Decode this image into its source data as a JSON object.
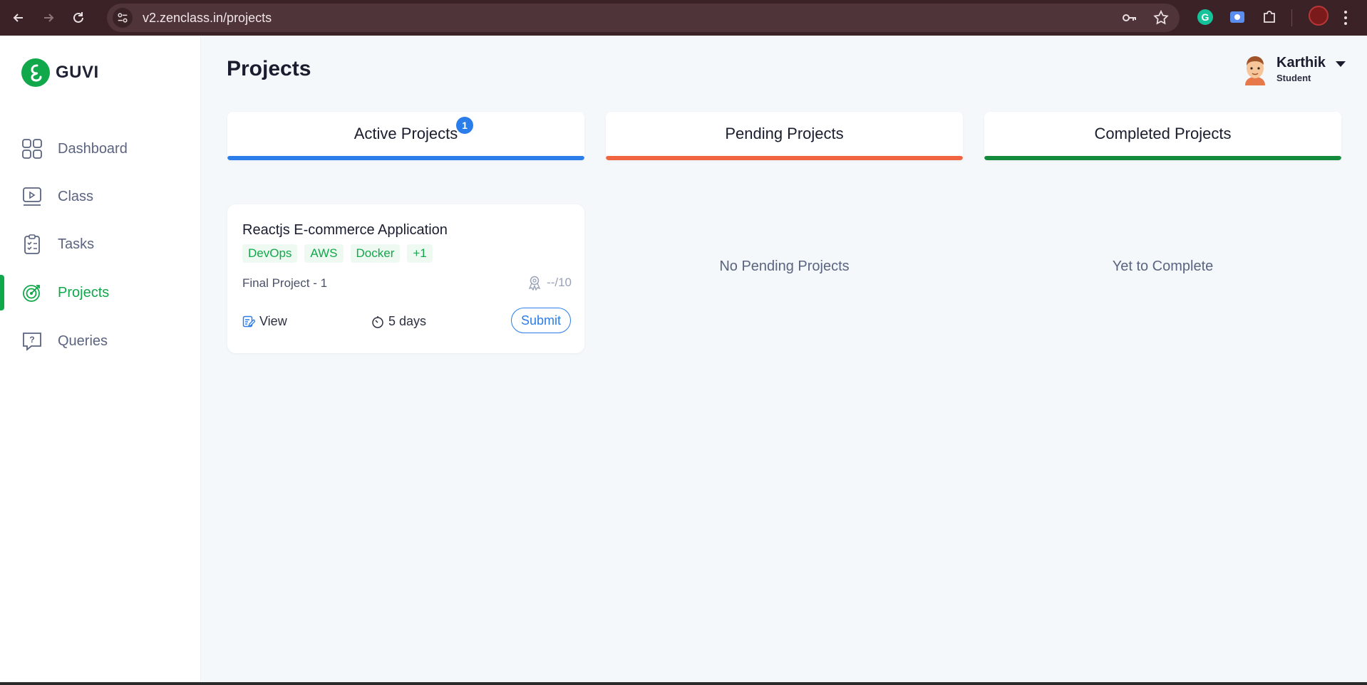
{
  "browser": {
    "url": "v2.zenclass.in/projects"
  },
  "brand": {
    "name": "GUVI"
  },
  "sidebar": {
    "items": [
      {
        "label": "Dashboard",
        "icon": "dashboard-grid-icon"
      },
      {
        "label": "Class",
        "icon": "video-class-icon"
      },
      {
        "label": "Tasks",
        "icon": "clipboard-tasks-icon"
      },
      {
        "label": "Projects",
        "icon": "target-projects-icon",
        "active": true
      },
      {
        "label": "Queries",
        "icon": "question-chat-icon"
      }
    ]
  },
  "header": {
    "title": "Projects",
    "user": {
      "name": "Karthik",
      "role": "Student"
    }
  },
  "tabs": [
    {
      "label": "Active Projects",
      "color": "#2b7de9",
      "badge": "1"
    },
    {
      "label": "Pending Projects",
      "color": "#f0643f"
    },
    {
      "label": "Completed Projects",
      "color": "#138a3c"
    }
  ],
  "project_card": {
    "title": "Reactjs E-commerce Application",
    "tags": [
      "DevOps",
      "AWS",
      "Docker",
      "+1"
    ],
    "subtitle": "Final Project - 1",
    "score": "--/10",
    "view_label": "View",
    "duration": "5 days",
    "submit_label": "Submit"
  },
  "pending_empty": "No Pending Projects",
  "completed_empty": "Yet to Complete",
  "colors": {
    "accent_green": "#11a84b",
    "accent_blue": "#2b7de9",
    "chrome_bg": "#3b2226"
  }
}
